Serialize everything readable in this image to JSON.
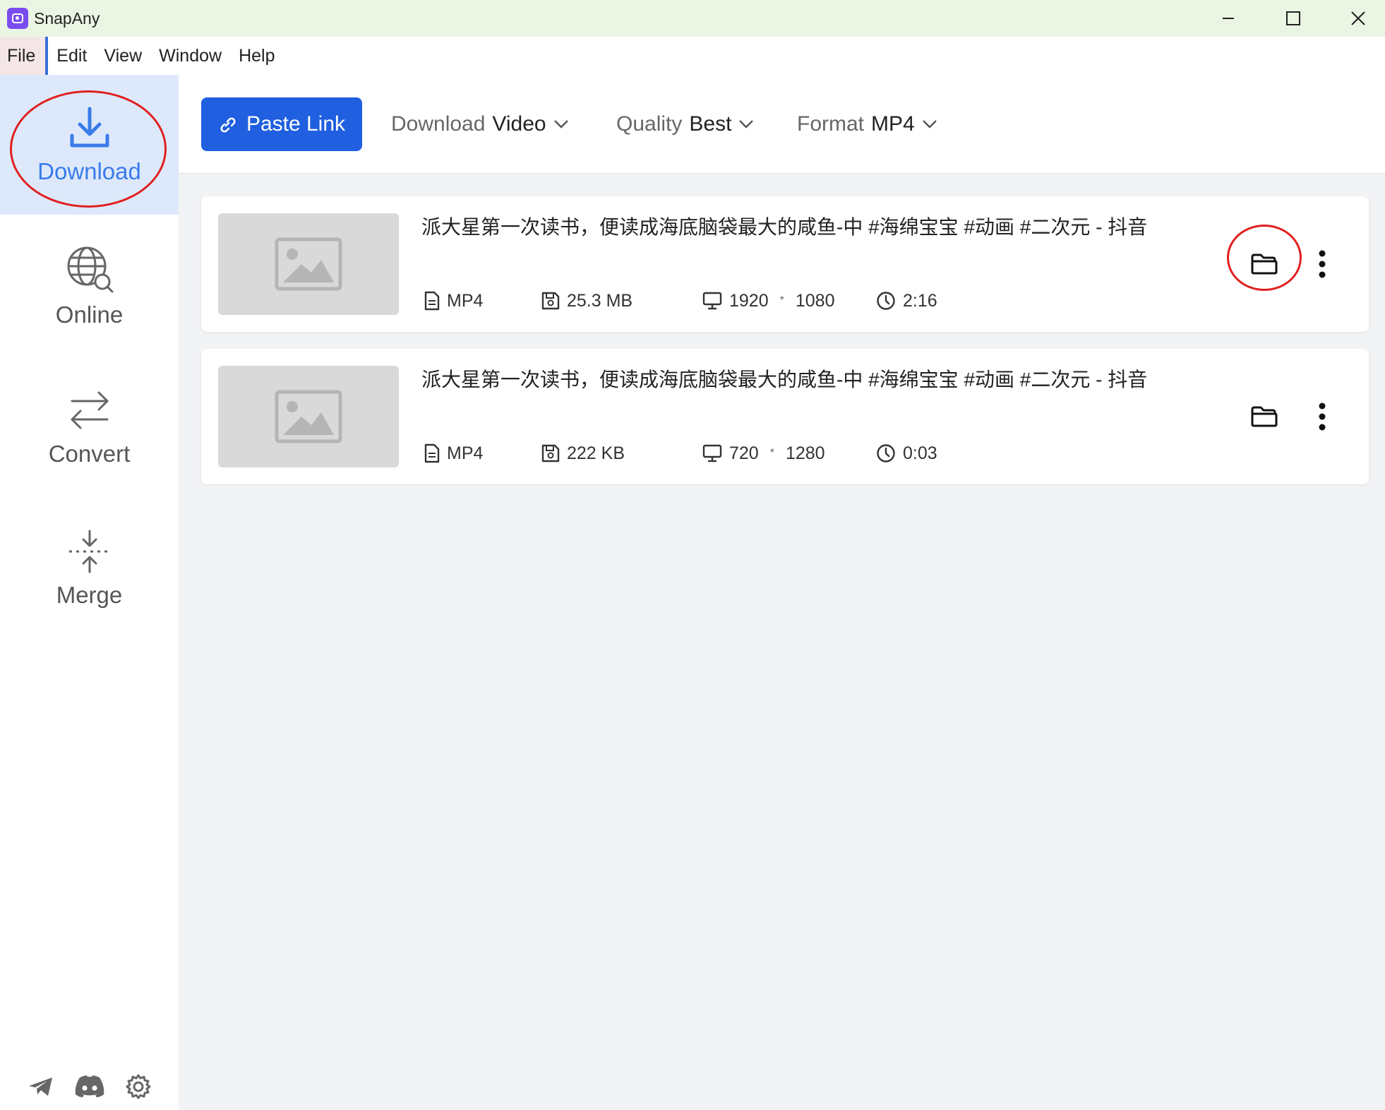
{
  "app": {
    "title": "SnapAny"
  },
  "menu": [
    "File",
    "Edit",
    "View",
    "Window",
    "Help"
  ],
  "sidebar": {
    "items": [
      {
        "label": "Download",
        "icon": "download-icon",
        "active": true
      },
      {
        "label": "Online",
        "icon": "globe-search-icon"
      },
      {
        "label": "Convert",
        "icon": "convert-arrows-icon"
      },
      {
        "label": "Merge",
        "icon": "merge-icon"
      }
    ],
    "footer_icons": [
      "telegram-icon",
      "discord-icon",
      "settings-gear-icon"
    ]
  },
  "toolbar": {
    "paste_label": "Paste Link",
    "download": {
      "key": "Download",
      "value": "Video"
    },
    "quality": {
      "key": "Quality",
      "value": "Best"
    },
    "format": {
      "key": "Format",
      "value": "MP4"
    }
  },
  "downloads": [
    {
      "title": "派大星第一次读书，便读成海底脑袋最大的咸鱼-中 #海绵宝宝 #动画 #二次元 - 抖音",
      "format": "MP4",
      "size": "25.3 MB",
      "width": "1920",
      "height": "1080",
      "duration": "2:16"
    },
    {
      "title": "派大星第一次读书，便读成海底脑袋最大的咸鱼-中 #海绵宝宝 #动画 #二次元 - 抖音",
      "format": "MP4",
      "size": "222 KB",
      "width": "720",
      "height": "1280",
      "duration": "0:03"
    }
  ],
  "colors": {
    "accent": "#1f5fe0",
    "active_nav_bg": "#dde9fb",
    "active_nav_text": "#3b7bea",
    "titlebar_bg": "#ebf5e3",
    "highlight_circle": "#e02020"
  }
}
